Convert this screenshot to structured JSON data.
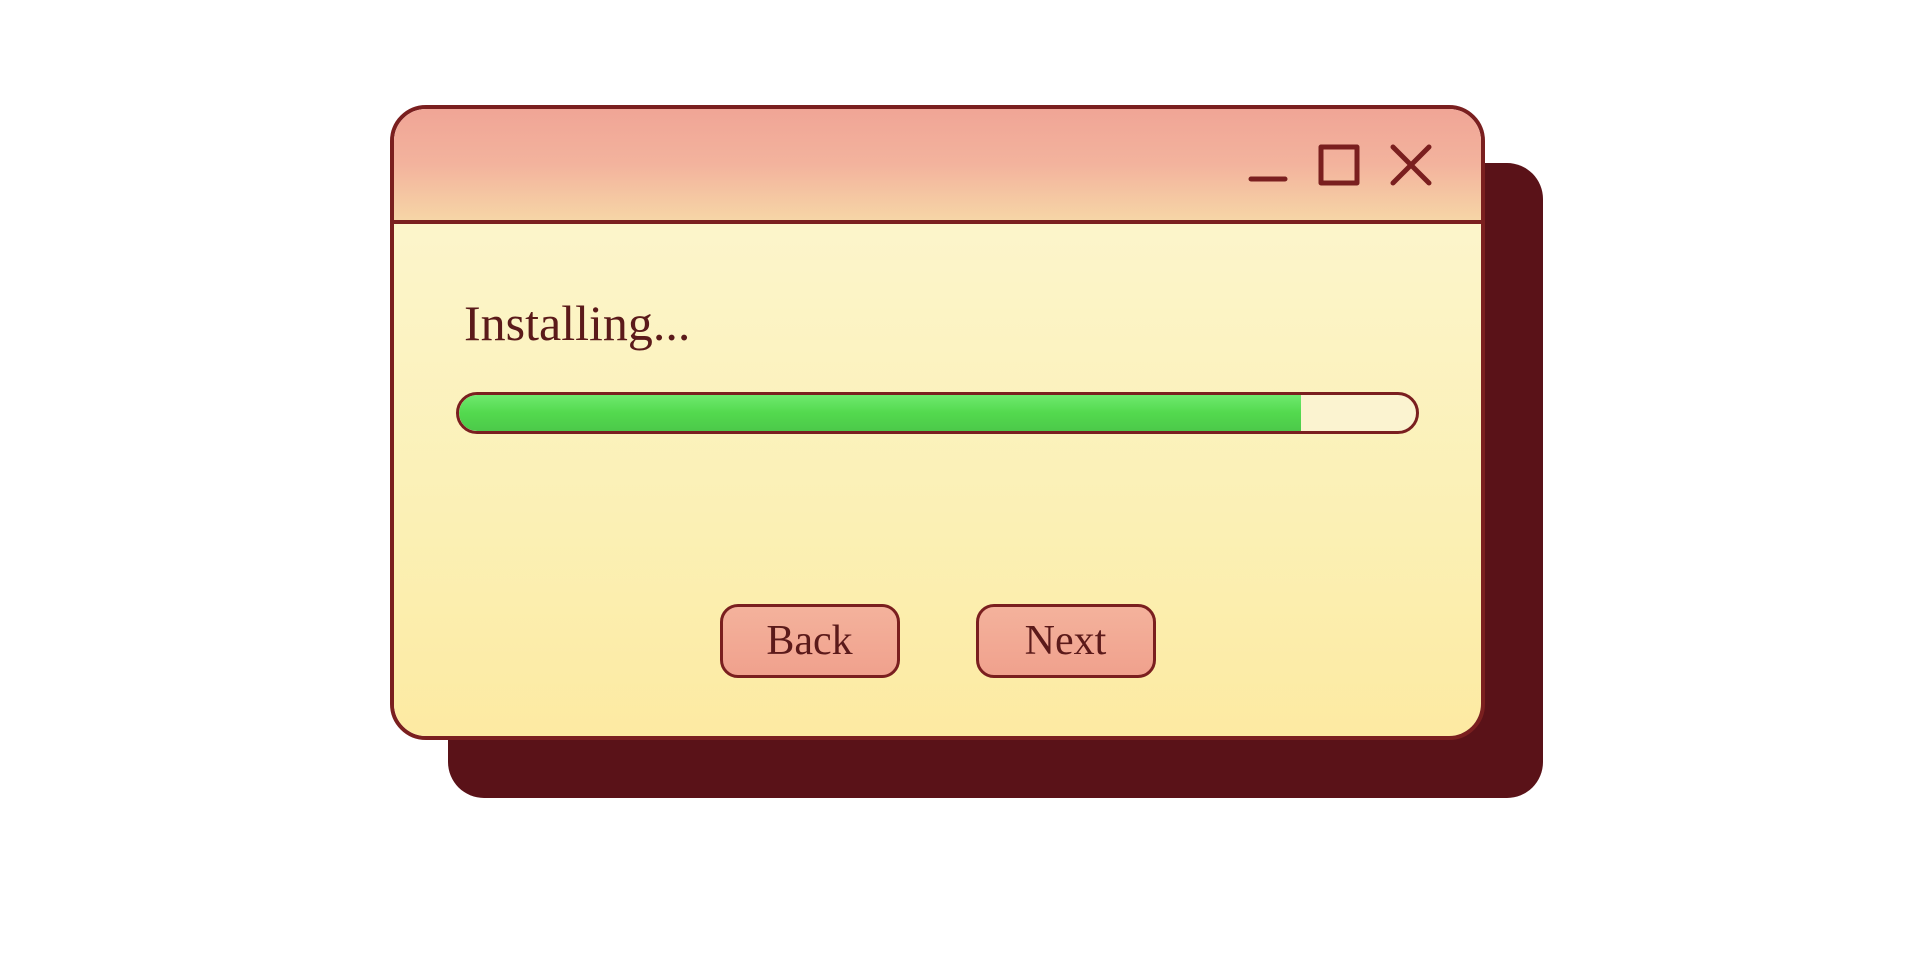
{
  "dialog": {
    "status_text": "Installing...",
    "progress_percent": 88,
    "buttons": {
      "back": "Back",
      "next": "Next"
    }
  },
  "colors": {
    "border": "#7a1f1f",
    "shadow": "#5a1218",
    "progress_fill": "#53d94e"
  }
}
